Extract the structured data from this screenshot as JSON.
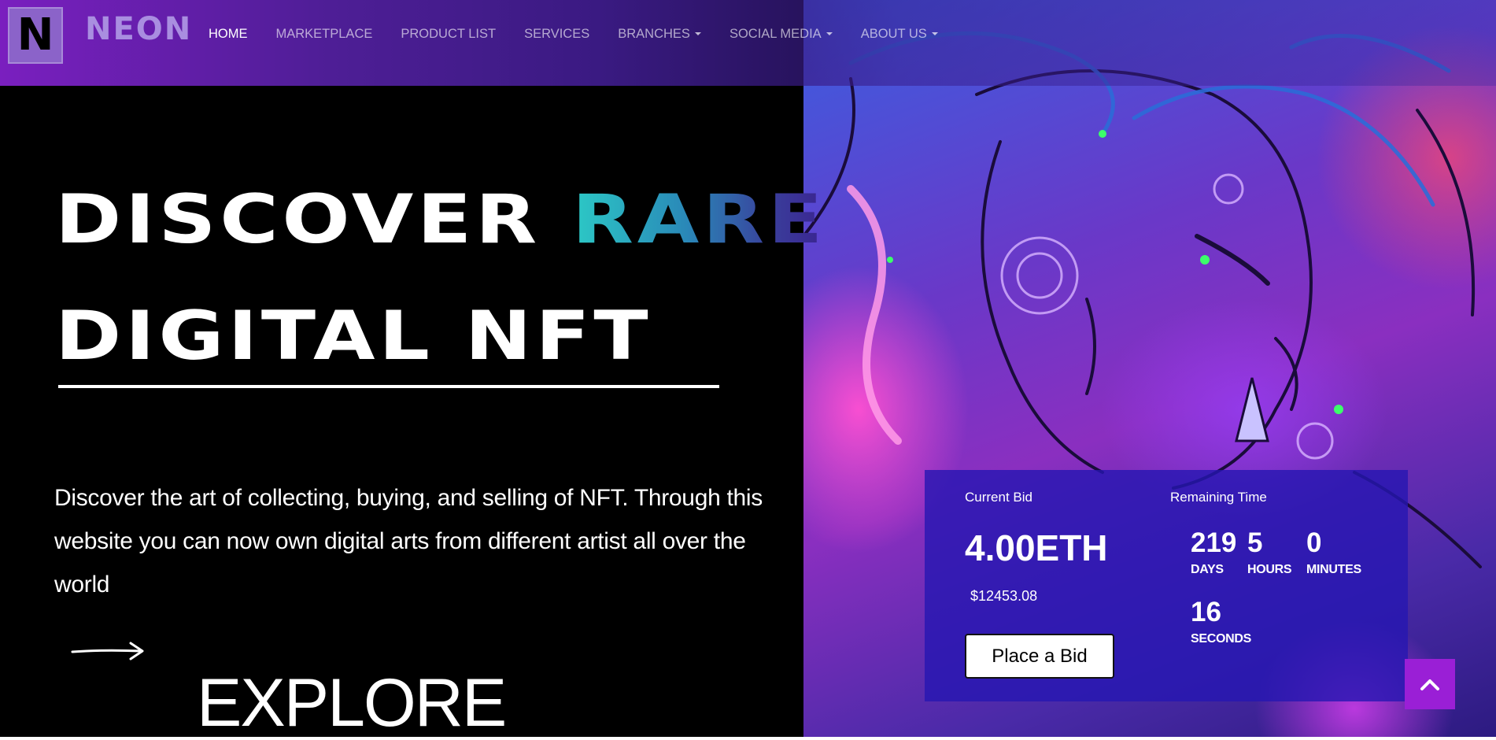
{
  "brand": {
    "logo_letter": "N",
    "name": "NEON"
  },
  "nav": {
    "items": [
      {
        "label": "HOME",
        "active": true,
        "dropdown": false
      },
      {
        "label": "MARKETPLACE",
        "active": false,
        "dropdown": false
      },
      {
        "label": "PRODUCT LIST",
        "active": false,
        "dropdown": false
      },
      {
        "label": "SERVICES",
        "active": false,
        "dropdown": false
      },
      {
        "label": "BRANCHES",
        "active": false,
        "dropdown": true
      },
      {
        "label": "SOCIAL MEDIA",
        "active": false,
        "dropdown": true
      },
      {
        "label": "ABOUT US",
        "active": false,
        "dropdown": true
      }
    ]
  },
  "hero": {
    "headline_part1": "DISCOVER",
    "headline_highlight": "RARE",
    "headline_line2": "DIGITAL NFT",
    "description": "Discover the art of collecting, buying, and selling of NFT. Through this website you can now own digital arts from different artist all over the world",
    "explore_label": "EXPLORE"
  },
  "bid": {
    "current_bid_label": "Current Bid",
    "amount": "4.00ETH",
    "usd_value": "$12453.08",
    "button_label": "Place a Bid",
    "remaining_label": "Remaining Time",
    "countdown": {
      "days": "219",
      "days_label": "DAYS",
      "hours": "5",
      "hours_label": "HOURS",
      "minutes": "0",
      "minutes_label": "MINUTES",
      "seconds": "16",
      "seconds_label": "SECONDS"
    }
  },
  "icons": {
    "arrow": "arrow-right-icon",
    "scroll_top": "chevron-up-icon",
    "caret": "caret-down-icon"
  },
  "colors": {
    "nav_gradient_start": "#7a1fbf",
    "brand_text": "#a98ee0",
    "rare_gradient": [
      "#2cc9c6",
      "#3a2390"
    ],
    "bid_card": "#2616b2",
    "scroll_top_button": "#9a1fd6"
  }
}
